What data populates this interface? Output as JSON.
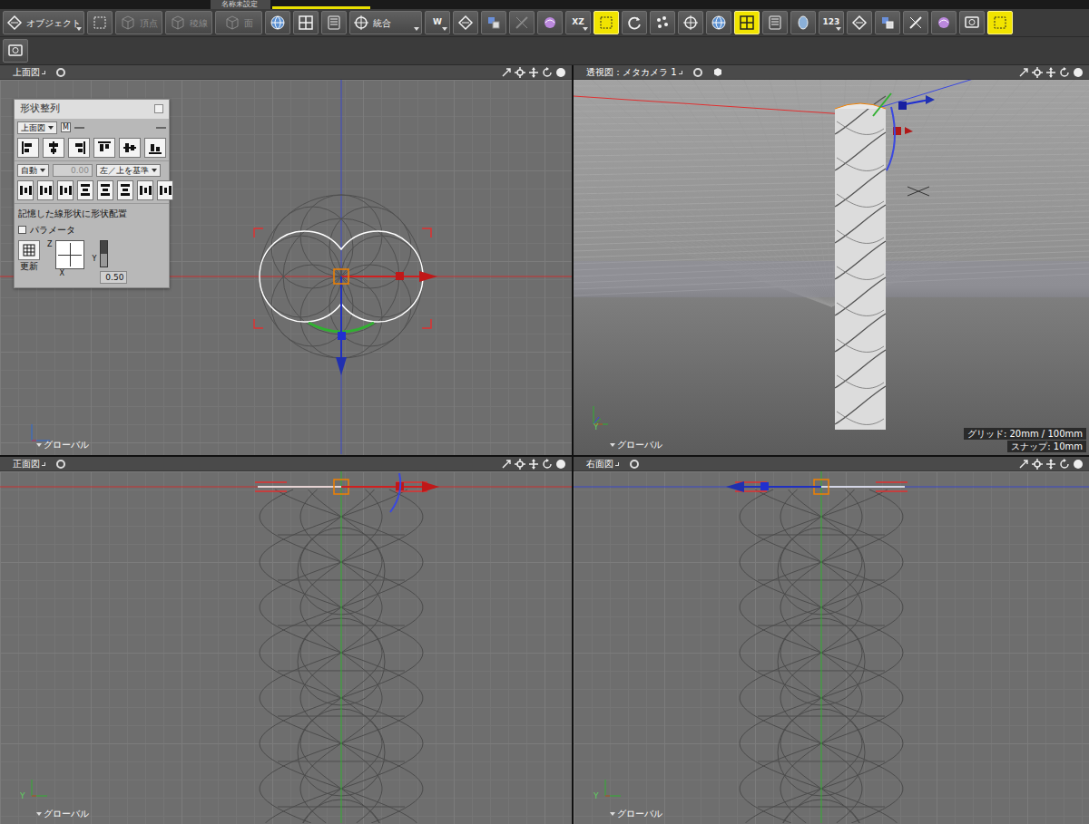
{
  "window": {
    "title": "名称未設定"
  },
  "toolbar": {
    "row1": [
      {
        "kind": "dropdown",
        "label": "オブジェクト",
        "selected": false,
        "disabled": false
      },
      {
        "kind": "icon",
        "selected": false,
        "disabled": false
      },
      {
        "kind": "mode",
        "label": "頂点",
        "selected": false,
        "disabled": true
      },
      {
        "kind": "mode",
        "label": "稜線",
        "selected": false,
        "disabled": true
      },
      {
        "kind": "mode",
        "label": "面",
        "selected": false,
        "disabled": true
      },
      {
        "kind": "icon",
        "selected": false,
        "disabled": false
      },
      {
        "kind": "icon",
        "selected": false,
        "disabled": false
      },
      {
        "kind": "icon",
        "selected": false,
        "disabled": false
      },
      {
        "kind": "dropdown",
        "label": "統合",
        "selected": false,
        "disabled": false
      },
      {
        "kind": "labeled",
        "label": "W",
        "selected": false,
        "disabled": false
      },
      {
        "kind": "icon",
        "selected": false,
        "disabled": false
      },
      {
        "kind": "icon",
        "selected": false,
        "disabled": true
      },
      {
        "kind": "icon",
        "selected": false,
        "disabled": true
      },
      {
        "kind": "icon",
        "selected": false,
        "disabled": false
      },
      {
        "kind": "labeled",
        "label": "XZ",
        "selected": false,
        "disabled": false
      },
      {
        "kind": "icon",
        "selected": true,
        "disabled": false
      },
      {
        "kind": "icon",
        "selected": false,
        "disabled": false
      },
      {
        "kind": "icon",
        "selected": false,
        "disabled": false
      },
      {
        "kind": "icon",
        "selected": false,
        "disabled": false
      },
      {
        "kind": "icon",
        "selected": false,
        "disabled": false
      },
      {
        "kind": "icon",
        "selected": true,
        "disabled": false
      },
      {
        "kind": "icon",
        "selected": false,
        "disabled": false
      },
      {
        "kind": "icon",
        "selected": false,
        "disabled": false
      },
      {
        "kind": "labeled",
        "label": "123",
        "selected": false,
        "disabled": false
      },
      {
        "kind": "icon",
        "selected": false,
        "disabled": false
      },
      {
        "kind": "icon",
        "selected": false,
        "disabled": false
      },
      {
        "kind": "icon",
        "selected": false,
        "disabled": false
      },
      {
        "kind": "icon",
        "selected": false,
        "disabled": false
      },
      {
        "kind": "icon",
        "selected": false,
        "disabled": false
      },
      {
        "kind": "icon",
        "selected": true,
        "disabled": false
      }
    ],
    "row2": [
      {
        "kind": "icon",
        "selected": false,
        "disabled": false
      }
    ]
  },
  "viewports": [
    {
      "kind": "top",
      "title": "上面図",
      "coord": "グローバル"
    },
    {
      "kind": "perspective",
      "title": "透視図：メタカメラ 1",
      "coord": "グローバル",
      "axis_label": "Y",
      "grid": "グリッド: 20mm / 100mm",
      "snap": "スナップ: 10mm"
    },
    {
      "kind": "front",
      "title": "正面図",
      "coord": "グローバル",
      "axis_label": "Y"
    },
    {
      "kind": "right",
      "title": "右面図",
      "coord": "グローバル",
      "axis_label": "Y"
    }
  ],
  "align_panel": {
    "title": "形状整列",
    "view": "上面図",
    "m_button": "M",
    "mode": "自動",
    "offset": {
      "value": "0.00",
      "disabled": true
    },
    "basis": "左／上を基準",
    "section": "記憶した線形状に形状配置",
    "parameter": {
      "label": "パラメータ",
      "checked": false
    },
    "update": "更新",
    "plane_axes": [
      "Z",
      "X"
    ],
    "slider": {
      "axis": "Y",
      "level": 0.5,
      "reading": "0.50"
    }
  }
}
